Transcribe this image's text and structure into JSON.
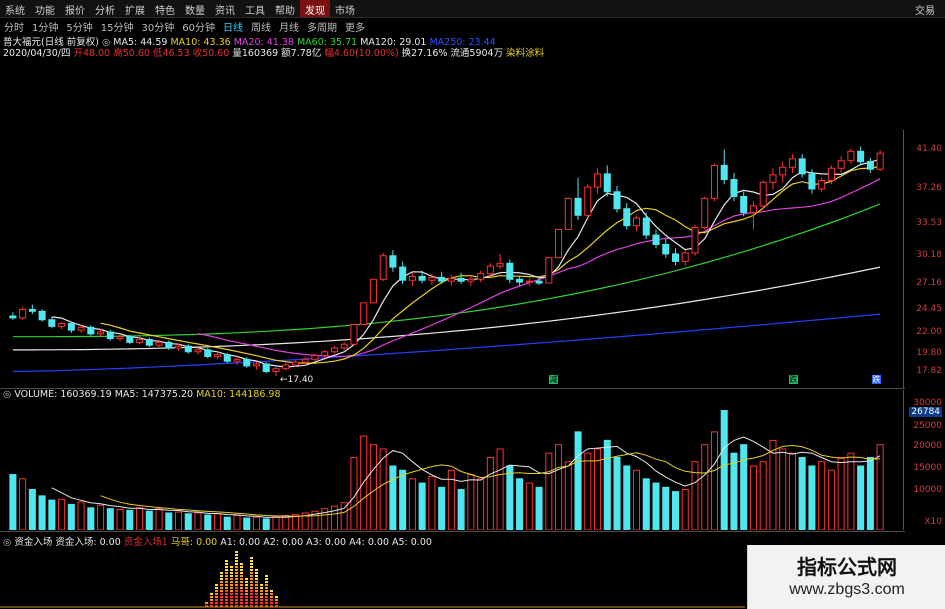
{
  "menubar": {
    "items": [
      "系统",
      "功能",
      "报价",
      "分析",
      "扩展",
      "特色",
      "数量",
      "资讯",
      "工具",
      "帮助",
      "发现",
      "市场"
    ],
    "highlight_index": 10,
    "trade": "交易"
  },
  "periods": {
    "items": [
      "分时",
      "1分钟",
      "5分钟",
      "15分钟",
      "30分钟",
      "60分钟",
      "日线",
      "周线",
      "月线",
      "多周期",
      "更多"
    ],
    "active_index": 6
  },
  "stock": {
    "name": "普大福元(日线 前复权)",
    "ma": [
      {
        "label": "MA5: 44.59",
        "color": "#e8e8e8"
      },
      {
        "label": "MA10: 43.36",
        "color": "#e8d020"
      },
      {
        "label": "MA20: 41.38",
        "color": "#e040e0"
      },
      {
        "label": "MA60: 35.71",
        "color": "#30d030"
      },
      {
        "label": "MA120: 29.01",
        "color": "#e8e8e8"
      },
      {
        "label": "MA250: 23.44",
        "color": "#3050ff"
      }
    ],
    "date": "2020/04/30/四",
    "fields": [
      {
        "label": "开48.00",
        "color": "#e03030"
      },
      {
        "label": "高50.60",
        "color": "#e03030"
      },
      {
        "label": "低46.53",
        "color": "#e03030"
      },
      {
        "label": "收50.60",
        "color": "#e03030"
      },
      {
        "label": "量160369",
        "color": "#e8e8e8"
      },
      {
        "label": "额7.78亿",
        "color": "#e8e8e8"
      },
      {
        "label": "幅4.60(10.00%)",
        "color": "#e03030"
      },
      {
        "label": "换27.16%",
        "color": "#e8e8e8"
      },
      {
        "label": "流通5904万",
        "color": "#e8e8e8"
      },
      {
        "label": "染料涂料",
        "color": "#e8d020"
      }
    ],
    "low_annotation": "17.40"
  },
  "price_axis": {
    "ticks": [
      "41.40",
      "37.26",
      "33.53",
      "30.18",
      "27.16",
      "24.45",
      "22.00",
      "19.80",
      "17.82"
    ]
  },
  "volume": {
    "title": "VOLUME: 160369.19",
    "ma5": "MA5: 147375.20",
    "ma10": "MA10: 144186.98",
    "ticks": [
      "30000",
      "26784",
      "25000",
      "20000",
      "15000",
      "10000"
    ],
    "unit": "X10"
  },
  "fund": {
    "title": "资金入场",
    "items": [
      {
        "label": "资金入场: 0.00",
        "color": "#e8e8e8"
      },
      {
        "label": "资金入场1",
        "color": "#e03030"
      },
      {
        "label": "马哥: 0.00",
        "color": "#e8d020"
      },
      {
        "label": "A1: 0.00",
        "color": "#e8e8e8"
      },
      {
        "label": "A2: 0.00",
        "color": "#e8e8e8"
      },
      {
        "label": "A3: 0.00",
        "color": "#e8e8e8"
      },
      {
        "label": "A4: 0.00",
        "color": "#e8e8e8"
      },
      {
        "label": "A5: 0.00",
        "color": "#e8e8e8"
      }
    ]
  },
  "markers": [
    "减",
    "跌",
    "跌"
  ],
  "watermark": {
    "title": "指标公式网",
    "url": "www.zbgs3.com"
  },
  "chart_data": {
    "type": "candlestick",
    "ylim": [
      17.0,
      42.5
    ],
    "candles": [
      [
        23.8,
        24.2,
        23.4,
        23.6
      ],
      [
        23.6,
        24.8,
        23.4,
        24.5
      ],
      [
        24.5,
        25.0,
        24.0,
        24.3
      ],
      [
        24.3,
        24.5,
        23.2,
        23.4
      ],
      [
        23.4,
        23.7,
        22.5,
        22.7
      ],
      [
        22.7,
        23.2,
        22.4,
        23.0
      ],
      [
        23.0,
        23.1,
        22.0,
        22.3
      ],
      [
        22.3,
        22.9,
        22.0,
        22.6
      ],
      [
        22.6,
        22.8,
        21.7,
        21.9
      ],
      [
        21.9,
        22.4,
        21.6,
        22.1
      ],
      [
        22.1,
        22.3,
        21.2,
        21.4
      ],
      [
        21.4,
        21.9,
        21.1,
        21.6
      ],
      [
        21.6,
        21.8,
        20.8,
        21.0
      ],
      [
        21.0,
        21.6,
        20.8,
        21.3
      ],
      [
        21.3,
        21.5,
        20.5,
        20.7
      ],
      [
        20.7,
        21.3,
        20.5,
        21.0
      ],
      [
        21.0,
        21.2,
        20.2,
        20.4
      ],
      [
        20.4,
        20.9,
        20.1,
        20.6
      ],
      [
        20.6,
        20.8,
        19.8,
        20.0
      ],
      [
        20.0,
        20.5,
        19.7,
        20.2
      ],
      [
        20.2,
        20.4,
        19.3,
        19.5
      ],
      [
        19.5,
        20.0,
        19.2,
        19.7
      ],
      [
        19.7,
        19.9,
        18.8,
        19.0
      ],
      [
        19.0,
        19.5,
        18.6,
        19.2
      ],
      [
        19.2,
        19.4,
        18.3,
        18.5
      ],
      [
        18.5,
        19.0,
        18.1,
        18.7
      ],
      [
        18.7,
        18.9,
        17.7,
        17.9
      ],
      [
        17.9,
        18.4,
        17.4,
        18.2
      ],
      [
        18.2,
        18.8,
        18.0,
        18.6
      ],
      [
        18.6,
        19.1,
        18.4,
        18.9
      ],
      [
        18.9,
        19.4,
        18.7,
        19.2
      ],
      [
        19.2,
        19.8,
        19.0,
        19.6
      ],
      [
        19.6,
        20.2,
        19.4,
        20.0
      ],
      [
        20.0,
        20.6,
        19.8,
        20.4
      ],
      [
        20.4,
        21.0,
        20.2,
        20.8
      ],
      [
        20.8,
        22.9,
        20.8,
        22.9
      ],
      [
        22.9,
        25.2,
        22.9,
        25.2
      ],
      [
        25.2,
        27.7,
        25.2,
        27.7
      ],
      [
        27.7,
        30.5,
        27.5,
        30.2
      ],
      [
        30.2,
        30.8,
        28.5,
        29.0
      ],
      [
        29.0,
        29.6,
        27.2,
        27.6
      ],
      [
        27.6,
        28.4,
        27.0,
        28.0
      ],
      [
        28.0,
        28.6,
        27.3,
        27.6
      ],
      [
        27.6,
        28.3,
        27.1,
        27.9
      ],
      [
        27.9,
        28.5,
        27.2,
        27.5
      ],
      [
        27.5,
        28.2,
        27.0,
        27.8
      ],
      [
        27.8,
        28.4,
        27.2,
        27.5
      ],
      [
        27.5,
        28.0,
        27.0,
        27.7
      ],
      [
        27.7,
        28.6,
        27.4,
        28.3
      ],
      [
        28.3,
        29.4,
        28.0,
        29.1
      ],
      [
        29.1,
        30.4,
        28.8,
        29.4
      ],
      [
        29.4,
        29.8,
        27.3,
        27.7
      ],
      [
        27.7,
        28.0,
        27.0,
        27.4
      ],
      [
        27.4,
        27.8,
        27.0,
        27.5
      ],
      [
        27.5,
        27.9,
        27.1,
        27.3
      ],
      [
        27.3,
        30.0,
        27.3,
        30.0
      ],
      [
        30.0,
        33.0,
        30.0,
        33.0
      ],
      [
        33.0,
        36.3,
        33.0,
        36.3
      ],
      [
        36.3,
        38.5,
        34.0,
        34.5
      ],
      [
        34.5,
        37.8,
        34.0,
        37.5
      ],
      [
        37.5,
        39.5,
        36.8,
        38.9
      ],
      [
        38.9,
        39.8,
        36.5,
        37.0
      ],
      [
        37.0,
        37.6,
        34.8,
        35.2
      ],
      [
        35.2,
        35.8,
        33.0,
        33.4
      ],
      [
        33.4,
        34.5,
        32.8,
        34.2
      ],
      [
        34.2,
        34.8,
        32.0,
        32.4
      ],
      [
        32.4,
        33.0,
        31.0,
        31.4
      ],
      [
        31.4,
        32.0,
        30.0,
        30.4
      ],
      [
        30.4,
        31.0,
        29.2,
        29.6
      ],
      [
        29.6,
        30.8,
        29.1,
        30.5
      ],
      [
        30.5,
        33.5,
        30.2,
        33.2
      ],
      [
        33.2,
        36.5,
        33.0,
        36.3
      ],
      [
        36.3,
        40.0,
        36.0,
        39.8
      ],
      [
        39.8,
        41.5,
        37.8,
        38.3
      ],
      [
        38.3,
        39.0,
        36.0,
        36.5
      ],
      [
        36.5,
        37.0,
        34.4,
        34.8
      ],
      [
        34.8,
        36.0,
        33.0,
        35.5
      ],
      [
        35.5,
        38.2,
        35.2,
        38.0
      ],
      [
        38.0,
        39.5,
        37.2,
        38.8
      ],
      [
        38.8,
        40.2,
        38.0,
        39.6
      ],
      [
        39.6,
        41.0,
        39.0,
        40.5
      ],
      [
        40.5,
        41.0,
        38.5,
        38.9
      ],
      [
        38.9,
        39.4,
        36.8,
        37.3
      ],
      [
        37.3,
        38.5,
        37.0,
        38.2
      ],
      [
        38.2,
        39.8,
        37.8,
        39.5
      ],
      [
        39.5,
        40.8,
        39.0,
        40.3
      ],
      [
        40.3,
        41.6,
        40.0,
        41.3
      ],
      [
        41.3,
        41.8,
        39.8,
        40.2
      ],
      [
        40.2,
        40.6,
        39.0,
        39.4
      ],
      [
        39.4,
        41.4,
        39.2,
        41.1
      ]
    ],
    "volume": [
      130,
      120,
      95,
      80,
      70,
      72,
      60,
      66,
      52,
      58,
      50,
      48,
      46,
      52,
      44,
      50,
      40,
      42,
      38,
      40,
      35,
      38,
      30,
      34,
      28,
      30,
      26,
      32,
      34,
      36,
      40,
      44,
      50,
      56,
      64,
      170,
      220,
      200,
      190,
      150,
      140,
      120,
      110,
      125,
      100,
      140,
      95,
      130,
      120,
      170,
      190,
      150,
      120,
      110,
      100,
      180,
      200,
      160,
      230,
      180,
      190,
      210,
      170,
      150,
      140,
      120,
      110,
      100,
      90,
      95,
      160,
      200,
      230,
      280,
      180,
      200,
      150,
      160,
      210,
      190,
      180,
      170,
      150,
      160,
      140,
      170,
      180,
      150,
      170,
      200
    ],
    "volume_ylim": [
      0,
      300
    ]
  }
}
